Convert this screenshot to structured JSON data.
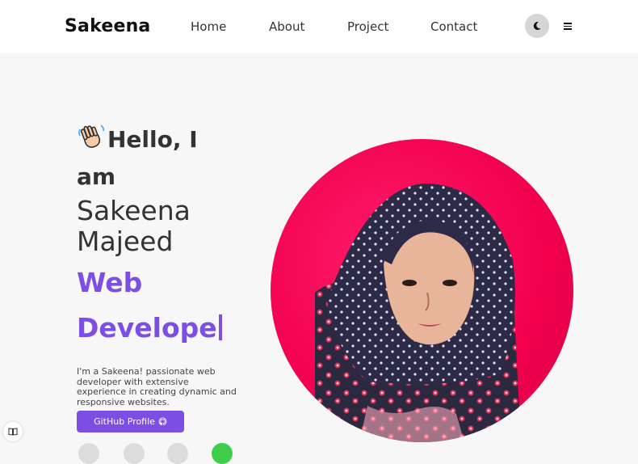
{
  "navbar": {
    "logo": "Sakeena",
    "links": [
      "Home",
      "About",
      "Project",
      "Contact"
    ],
    "theme_icon": "moon-icon",
    "menu_icon": "hamburger-icon"
  },
  "hero": {
    "greeting_line1": "Hello, I",
    "greeting_line2": "am",
    "name_line1": "Sakeena",
    "name_line2": "Majeed",
    "role_line1": "Web",
    "role_line2": "Develope",
    "description": "I'm a Sakeena! passionate web developer with extensive experience in creating dynamic and responsive websites.",
    "github_button": "GitHub Profile"
  },
  "colors": {
    "accent": "#7c4ee4",
    "photo_bg": "#f2004e",
    "nav_bg": "#ffffff",
    "page_bg": "#f7f7f7"
  }
}
